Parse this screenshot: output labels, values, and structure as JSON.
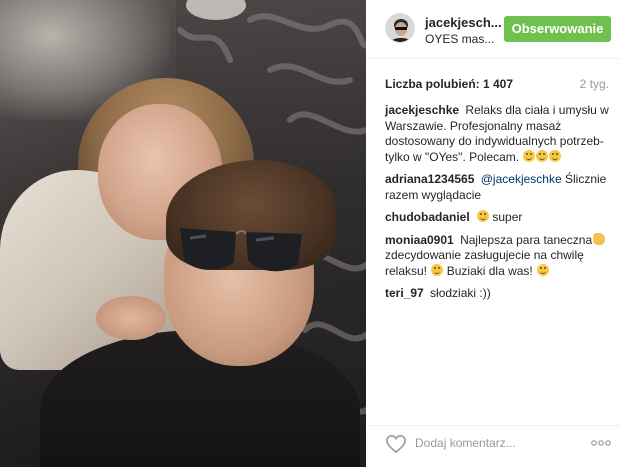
{
  "post": {
    "username": "jacekjesch...",
    "location": "OYES mas...",
    "follow_label": "Obserwowanie",
    "likes": "Liczba polubień: 1 407",
    "time": "2 tyg."
  },
  "comments": [
    {
      "user": "jacekjeschke",
      "text": "Relaks dla ciała i umysłu w Warszawie. Profesjonalny masaż dostosowany do indywidualnych potrzeb- tylko w \"OYes\". Polecam.",
      "emojis": [
        "smile-emoji",
        "smile-emoji",
        "wink-emoji"
      ]
    },
    {
      "user": "adriana1234565",
      "mention": "@jacekjeschke",
      "text": "Ślicznie razem wyglądacie",
      "emojis": []
    },
    {
      "user": "chudobadaniel",
      "text": "super",
      "emojis": [
        "wink-emoji"
      ]
    },
    {
      "user": "moniaa0901",
      "text": "Najlepsza para taneczna",
      "text2": "zdecydowanie zasługujecie na chwilę relaksu!",
      "text3": "Buziaki dla was!",
      "emojis": [
        "muscle-emoji",
        "smile-emoji",
        "kiss-emoji"
      ]
    },
    {
      "user": "teri_97",
      "text": "słodziaki :))",
      "emojis": []
    }
  ],
  "footer": {
    "add_comment_placeholder": "Dodaj komentarz...",
    "icons": [
      "heart-icon",
      "more-options-icon"
    ]
  },
  "colors": {
    "follow_button": "#70c050",
    "mention": "#003569",
    "muted": "#999999",
    "text": "#262626"
  }
}
